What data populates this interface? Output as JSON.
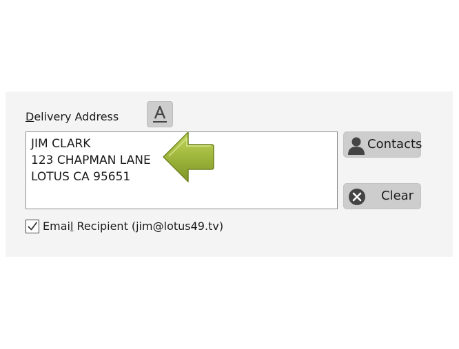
{
  "delivery": {
    "label_first": "D",
    "label_rest": "elivery Address",
    "address_lines": [
      "JIM CLARK",
      "123 CHAPMAN LANE",
      "LOTUS CA 95651"
    ]
  },
  "buttons": {
    "font_icon": "font-format-icon",
    "contacts_label": "Contacts",
    "contacts_icon": "person-icon",
    "clear_label": "Clear",
    "clear_icon": "close-circle-icon"
  },
  "email": {
    "checked": true,
    "label_pre": "Emai",
    "label_mnemonic": "l",
    "label_post": " Recipient (jim@lotus49.tv)"
  },
  "colors": {
    "panel_bg": "#f4f4f4",
    "button_bg": "#cdcdcd",
    "arrow_green": "#9bb33a",
    "icon_dark": "#444444"
  }
}
